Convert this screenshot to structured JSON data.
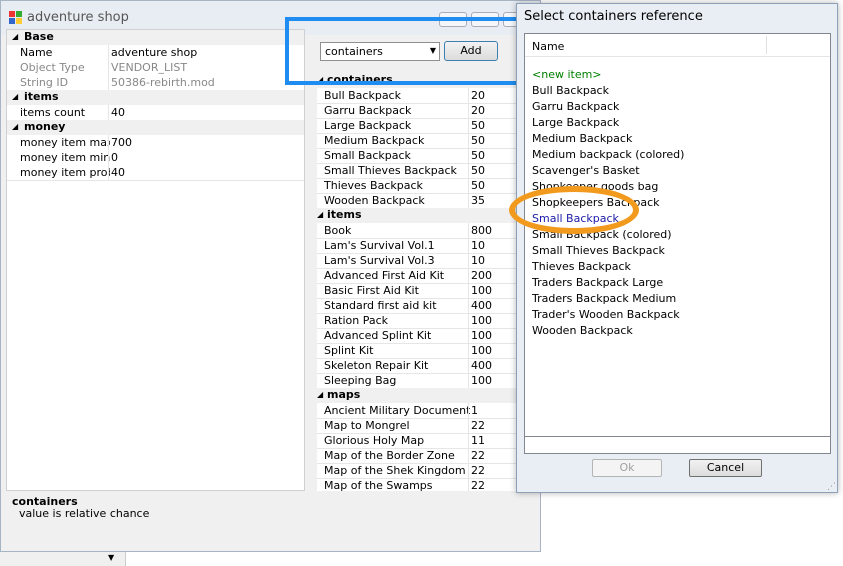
{
  "window": {
    "title": "adventure shop"
  },
  "left_grid": {
    "sections": [
      {
        "name": "Base",
        "rows": [
          {
            "key": "Name",
            "value": "adventure shop",
            "muted": false
          },
          {
            "key": "Object Type",
            "value": "VENDOR_LIST",
            "muted": true
          },
          {
            "key": "String ID",
            "value": "50386-rebirth.mod",
            "muted": true
          }
        ]
      },
      {
        "name": "items",
        "rows": [
          {
            "key": "items count",
            "value": "40",
            "muted": false
          }
        ]
      },
      {
        "name": "money",
        "rows": [
          {
            "key": "money item max",
            "value": "700",
            "muted": false
          },
          {
            "key": "money item min",
            "value": "0",
            "muted": false
          },
          {
            "key": "money item prob",
            "value": "40",
            "muted": false
          }
        ]
      }
    ]
  },
  "toolbar": {
    "combo_value": "containers",
    "add_label": "Add"
  },
  "right_grid": {
    "sections": [
      {
        "name": "containers",
        "rows": [
          {
            "key": "Bull Backpack",
            "value": "20"
          },
          {
            "key": "Garru Backpack",
            "value": "20"
          },
          {
            "key": "Large Backpack",
            "value": "50"
          },
          {
            "key": "Medium Backpack",
            "value": "50"
          },
          {
            "key": "Small Backpack",
            "value": "50"
          },
          {
            "key": "Small Thieves Backpack",
            "value": "50"
          },
          {
            "key": "Thieves Backpack",
            "value": "50"
          },
          {
            "key": "Wooden Backpack",
            "value": "35"
          }
        ]
      },
      {
        "name": "items",
        "rows": [
          {
            "key": "Book",
            "value": "800"
          },
          {
            "key": "Lam's Survival Vol.1",
            "value": "10"
          },
          {
            "key": "Lam's Survival Vol.3",
            "value": "10"
          },
          {
            "key": "Advanced First Aid Kit",
            "value": "200"
          },
          {
            "key": "Basic First Aid Kit",
            "value": "100"
          },
          {
            "key": "Standard first aid kit",
            "value": "400"
          },
          {
            "key": "Ration Pack",
            "value": "100"
          },
          {
            "key": "Advanced Splint Kit",
            "value": "100"
          },
          {
            "key": "Splint Kit",
            "value": "100"
          },
          {
            "key": "Skeleton Repair Kit",
            "value": "400"
          },
          {
            "key": "Sleeping Bag",
            "value": "100"
          }
        ]
      },
      {
        "name": "maps",
        "rows": [
          {
            "key": "Ancient Military Documents",
            "value": "1"
          },
          {
            "key": "Map to Mongrel",
            "value": "22"
          },
          {
            "key": "Glorious Holy Map",
            "value": "11"
          },
          {
            "key": "Map of the Border Zone",
            "value": "22"
          },
          {
            "key": "Map of the Shek Kingdom",
            "value": "22"
          },
          {
            "key": "Map of the Swamps",
            "value": "22"
          }
        ]
      }
    ]
  },
  "description": {
    "title": "containers",
    "text": "value is relative chance"
  },
  "dialog": {
    "title": "Select containers reference",
    "column_header": "Name",
    "items": [
      {
        "label": "<new item>",
        "style": "new"
      },
      {
        "label": "Bull Backpack",
        "style": "normal"
      },
      {
        "label": "Garru Backpack",
        "style": "normal"
      },
      {
        "label": "Large Backpack",
        "style": "normal"
      },
      {
        "label": "Medium Backpack",
        "style": "normal"
      },
      {
        "label": "Medium backpack (colored)",
        "style": "normal"
      },
      {
        "label": "Scavenger's Basket",
        "style": "normal"
      },
      {
        "label": "Shopkeeper goods bag",
        "style": "normal"
      },
      {
        "label": "Shopkeepers Backpack",
        "style": "normal"
      },
      {
        "label": "Small Backpack",
        "style": "selected"
      },
      {
        "label": "Small Backpack (colored)",
        "style": "normal"
      },
      {
        "label": "Small Thieves Backpack",
        "style": "normal"
      },
      {
        "label": "Thieves Backpack",
        "style": "normal"
      },
      {
        "label": "Traders Backpack Large",
        "style": "normal"
      },
      {
        "label": "Traders Backpack Medium",
        "style": "normal"
      },
      {
        "label": "Trader's Wooden Backpack",
        "style": "normal"
      },
      {
        "label": "Wooden Backpack",
        "style": "normal"
      }
    ],
    "ok_label": "Ok",
    "cancel_label": "Cancel"
  },
  "colors": {
    "new_item": "#008000",
    "selected_item": "#1a1aa8",
    "blue_highlight": "#1e8cf0",
    "orange_highlight": "#f29a1e"
  }
}
